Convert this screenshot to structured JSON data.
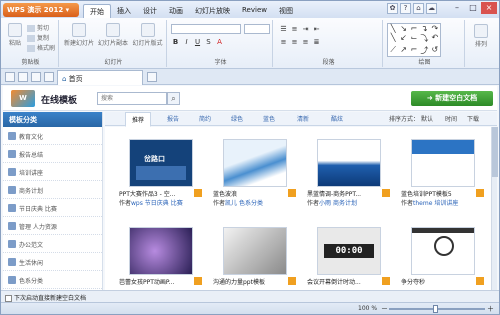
{
  "app": {
    "name": "WPS 演示 2012"
  },
  "ribbon_tabs": [
    "开始",
    "插入",
    "设计",
    "动画",
    "幻灯片放映",
    "Review",
    "视图"
  ],
  "ribbon": {
    "paste": "粘贴",
    "clipboard_items": [
      "剪切",
      "复制",
      "格式刷"
    ],
    "clipboard_label": "剪贴板",
    "new_slide": "新建幻灯片",
    "slide_copy": "幻灯片副本",
    "slide_layout": "幻灯片版式",
    "slides_label": "幻灯片",
    "font_label": "字体",
    "paragraph_label": "段落",
    "drawing_label": "绘图",
    "arrange": "排列"
  },
  "doc_tab": {
    "title": "首页"
  },
  "online": {
    "title": "在线模板",
    "search_placeholder": "搜索",
    "new_blank": "新建空白文档"
  },
  "sidebar": {
    "heading": "模板分类",
    "items": [
      "教育文化",
      "报告总结",
      "培训讲座",
      "商务计划",
      "节日庆典 比赛",
      "管理 人力资源",
      "办公范文",
      "生活休闲",
      "色系分类"
    ]
  },
  "categories": [
    "推荐",
    "报告",
    "简约",
    "绿色",
    "蓝色",
    "清新",
    "酷炫"
  ],
  "sort": {
    "label": "排序方式：",
    "options": [
      "默认",
      "时间",
      "下载"
    ]
  },
  "cards": [
    {
      "title": "PPT大赛作品3 - 空...",
      "author_label": "作者",
      "author": "wps",
      "tags": "节日庆典 比赛"
    },
    {
      "title": "蓝色波浪",
      "author_label": "作者",
      "author": "凯儿",
      "tags": "色系分类"
    },
    {
      "title": "黑蓝情调-商务PPT...",
      "author_label": "作者",
      "author": "小雨",
      "tags": "商务计划"
    },
    {
      "title": "蓝色培训PPT模板5",
      "author_label": "作者",
      "author": "theme",
      "tags": "培训讲座"
    },
    {
      "title": "芭蕾女孩PPT动画P...",
      "author_label": "",
      "author": "",
      "tags": ""
    },
    {
      "title": "沟通的力量ppt模板",
      "author_label": "",
      "author": "",
      "tags": ""
    },
    {
      "title": "会议开幕倒计时动...",
      "author_label": "",
      "author": "",
      "tags": ""
    },
    {
      "title": "争分夺秒",
      "author_label": "",
      "author": "",
      "tags": ""
    }
  ],
  "thumb_texts": {
    "road": "岔路口",
    "countdown": "00:00"
  },
  "status": {
    "checkbox_label": "下次启动直接新建空白文档"
  },
  "zoom": {
    "value": "100 %",
    "minus": "－",
    "plus": "＋"
  },
  "colors": {
    "accent": "#2a67a6",
    "orange": "#e8781e",
    "green": "#3a9e30"
  }
}
